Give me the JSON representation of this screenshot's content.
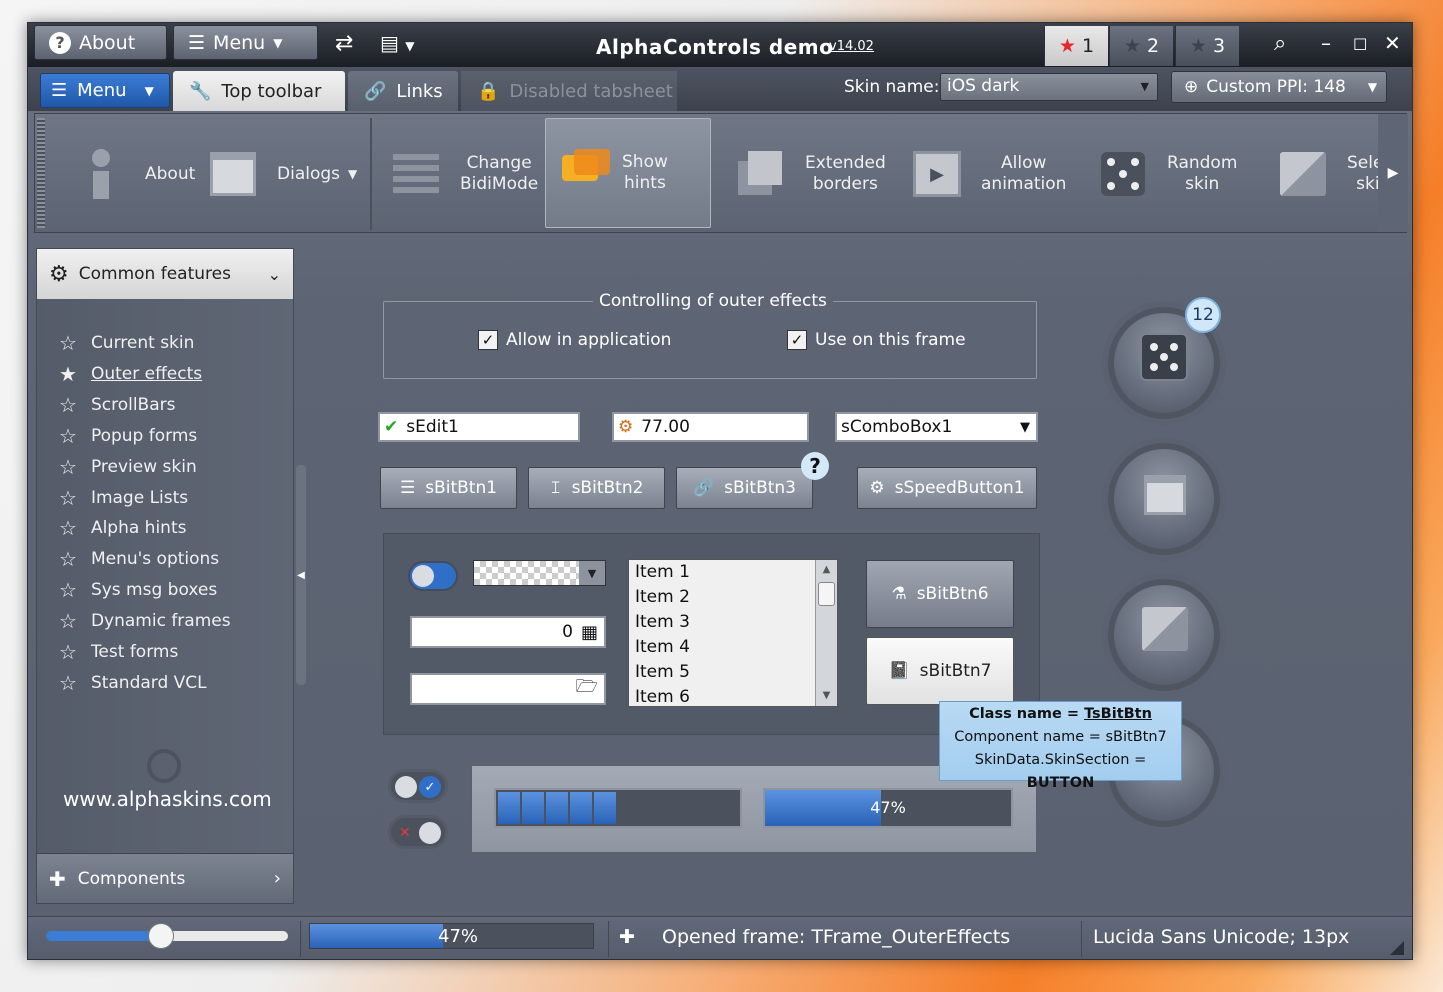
{
  "title": {
    "about": "About",
    "menu": "Menu",
    "app_title": "AlphaControls demo",
    "version": "v14.02",
    "stars": [
      "1",
      "2",
      "3"
    ]
  },
  "tabs": {
    "menu": "Menu",
    "top_toolbar": "Top toolbar",
    "links": "Links",
    "disabled": "Disabled tabsheet",
    "skin_label": "Skin name:",
    "skin_value": "iOS dark",
    "ppi": "Custom PPI: 148"
  },
  "toolbar": {
    "about": "About",
    "dialogs": "Dialogs",
    "change_bidi": "Change\nBidiMode",
    "show_hints": "Show\nhints",
    "extended_borders": "Extended\nborders",
    "allow_animation": "Allow\nanimation",
    "random_skin": "Random\nskin",
    "select_skin": "Select\nskin"
  },
  "sidebar": {
    "header": "Common features",
    "items": [
      "Current skin",
      "Outer effects",
      "ScrollBars",
      "Popup forms",
      "Preview skin",
      "Image Lists",
      "Alpha hints",
      "Menu's options",
      "Sys msg boxes",
      "Dynamic frames",
      "Test forms",
      "Standard VCL"
    ],
    "url": "www.alphaskins.com",
    "footer": "Components"
  },
  "main": {
    "group_title": "Controlling of outer effects",
    "allow_app": "Allow in application",
    "use_frame": "Use on this frame",
    "edit1": "sEdit1",
    "edit2": "77.00",
    "combo": "sComboBox1",
    "btn1": "sBitBtn1",
    "btn2": "sBitBtn2",
    "btn3": "sBitBtn3",
    "speed": "sSpeedButton1",
    "spin_value": "0",
    "list": [
      "Item 1",
      "Item 2",
      "Item 3",
      "Item 4",
      "Item 5",
      "Item 6"
    ],
    "btn6": "sBitBtn6",
    "btn7": "sBitBtn7",
    "badge": "12",
    "progress2": "47%"
  },
  "hint": {
    "class_label": "Class name = ",
    "class_value": "TsBitBtn",
    "component": "Component name = sBitBtn7",
    "skin_label": "SkinData.SkinSection = ",
    "skin_value": "BUTTON"
  },
  "status": {
    "progress": "47%",
    "frame": "Opened frame: TFrame_OuterEffects",
    "font": "Lucida Sans Unicode; 13px"
  },
  "colors": {
    "accent": "#2f6fc8",
    "star": "#e8262c",
    "check": "#26a826"
  }
}
